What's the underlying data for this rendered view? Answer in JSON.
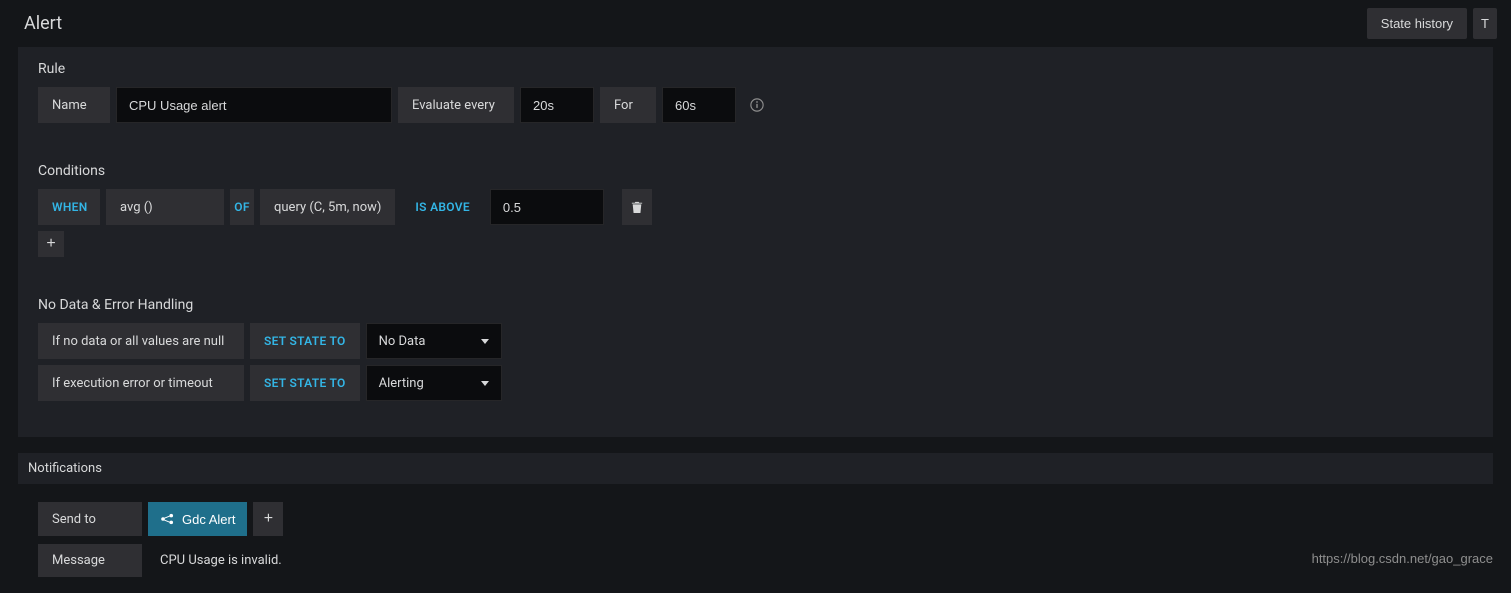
{
  "header": {
    "title": "Alert",
    "state_history_btn": "State history",
    "truncated_btn": "T"
  },
  "rule": {
    "heading": "Rule",
    "name_label": "Name",
    "name_value": "CPU Usage alert",
    "evaluate_label": "Evaluate every",
    "evaluate_value": "20s",
    "for_label": "For",
    "for_value": "60s"
  },
  "conditions": {
    "heading": "Conditions",
    "when_label": "WHEN",
    "reducer": "avg ()",
    "of_label": "OF",
    "query": "query (C, 5m, now)",
    "evaluator_label": "IS ABOVE",
    "threshold": "0.5"
  },
  "nodata": {
    "heading": "No Data & Error Handling",
    "row1_label": "If no data or all values are null",
    "set_state_to": "SET STATE TO",
    "row1_value": "No Data",
    "row2_label": "If execution error or timeout",
    "row2_value": "Alerting"
  },
  "notifications": {
    "heading": "Notifications",
    "send_to_label": "Send to",
    "channel": "Gdc Alert",
    "message_label": "Message",
    "message_value": "CPU Usage is invalid."
  },
  "watermark": "https://blog.csdn.net/gao_grace"
}
